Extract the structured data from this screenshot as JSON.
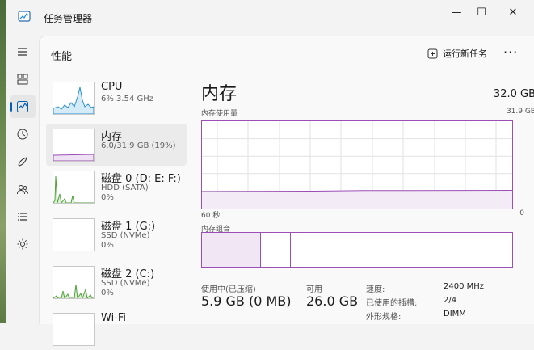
{
  "window": {
    "title": "任务管理器",
    "minimize": "—",
    "maximize": "☐",
    "close": "✕"
  },
  "header": {
    "page_title": "性能",
    "run_task": "运行新任务",
    "more": "···"
  },
  "nav": [
    "hamburger-menu-icon",
    "processes-icon",
    "performance-icon",
    "app-history-icon",
    "startup-apps-icon",
    "users-icon",
    "details-icon",
    "services-icon"
  ],
  "items": [
    {
      "name": "CPU",
      "sub1": "6%  3.54 GHz",
      "sub2": ""
    },
    {
      "name": "内存",
      "sub1": "6.0/31.9 GB (19%)",
      "sub2": ""
    },
    {
      "name": "磁盘 0 (D: E: F:)",
      "sub1": "HDD (SATA)",
      "sub2": "0%"
    },
    {
      "name": "磁盘 1 (G:)",
      "sub1": "SSD (NVMe)",
      "sub2": "0%"
    },
    {
      "name": "磁盘 2 (C:)",
      "sub1": "SSD (NVMe)",
      "sub2": "0%"
    },
    {
      "name": "Wi-Fi",
      "sub1": "",
      "sub2": ""
    }
  ],
  "detail": {
    "title": "内存",
    "total": "32.0 GB",
    "usage_label": "内存使用量",
    "usage_max": "31.9 GB",
    "time_label": "60 秒",
    "time_zero": "0",
    "composition_label": "内存组合",
    "in_use_label": "使用中(已压缩)",
    "in_use_value": "5.9 GB (0 MB)",
    "available_label": "可用",
    "available_value": "26.0 GB",
    "specs": [
      {
        "key": "速度:",
        "value": "2400 MHz"
      },
      {
        "key": "已使用的插槽:",
        "value": "2/4"
      },
      {
        "key": "外形规格:",
        "value": "DIMM"
      }
    ]
  },
  "colors": {
    "memory": "#9b4fb5",
    "cpu": "#2b8fd0",
    "disk": "#4ea23a",
    "accent": "#005fb8"
  }
}
